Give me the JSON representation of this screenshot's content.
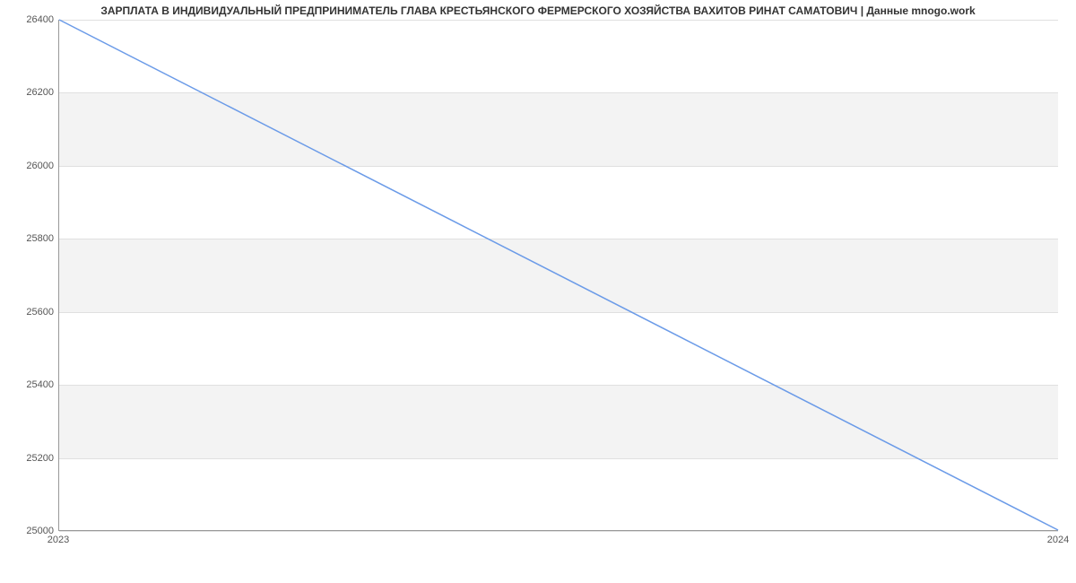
{
  "chart_data": {
    "type": "line",
    "title": "ЗАРПЛАТА В ИНДИВИДУАЛЬНЫЙ ПРЕДПРИНИМАТЕЛЬ ГЛАВА КРЕСТЬЯНСКОГО ФЕРМЕРСКОГО ХОЗЯЙСТВА ВАХИТОВ РИНАТ САМАТОВИЧ | Данные mnogo.work",
    "xlabel": "",
    "ylabel": "",
    "x": [
      2023,
      2024
    ],
    "values": [
      26400,
      25000
    ],
    "x_ticks": [
      "2023",
      "2024"
    ],
    "y_ticks": [
      "25000",
      "25200",
      "25400",
      "25600",
      "25800",
      "26000",
      "26200",
      "26400"
    ],
    "ylim": [
      25000,
      26400
    ],
    "xlim": [
      2023,
      2024
    ]
  }
}
